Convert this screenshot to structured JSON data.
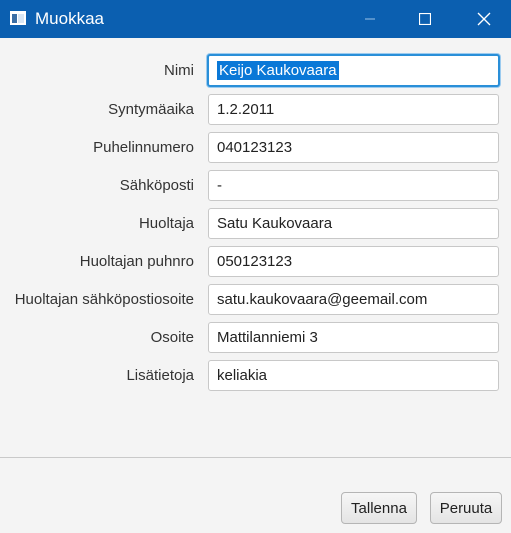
{
  "window": {
    "title": "Muokkaa",
    "controls": [
      "minimize-icon",
      "maximize-icon",
      "close-icon"
    ]
  },
  "form": {
    "fields": [
      {
        "label": "Nimi",
        "value": "Keijo Kaukovaara"
      },
      {
        "label": "Syntymäaika",
        "value": "1.2.2011"
      },
      {
        "label": "Puhelinnumero",
        "value": "040123123"
      },
      {
        "label": "Sähköposti",
        "value": "-"
      },
      {
        "label": "Huoltaja",
        "value": "Satu Kaukovaara"
      },
      {
        "label": "Huoltajan puhnro",
        "value": "050123123"
      },
      {
        "label": "Huoltajan sähköpostiosoite",
        "value": "satu.kaukovaara@geemail.com"
      },
      {
        "label": "Osoite",
        "value": "Mattilanniemi 3"
      },
      {
        "label": "Lisätietoja",
        "value": "keliakia"
      }
    ]
  },
  "buttons": {
    "save": "Tallenna",
    "cancel": "Peruuta"
  },
  "colors": {
    "titlebar": "#0b5fb0",
    "focus_border": "#2a8fd8",
    "selection": "#0a78d7"
  }
}
